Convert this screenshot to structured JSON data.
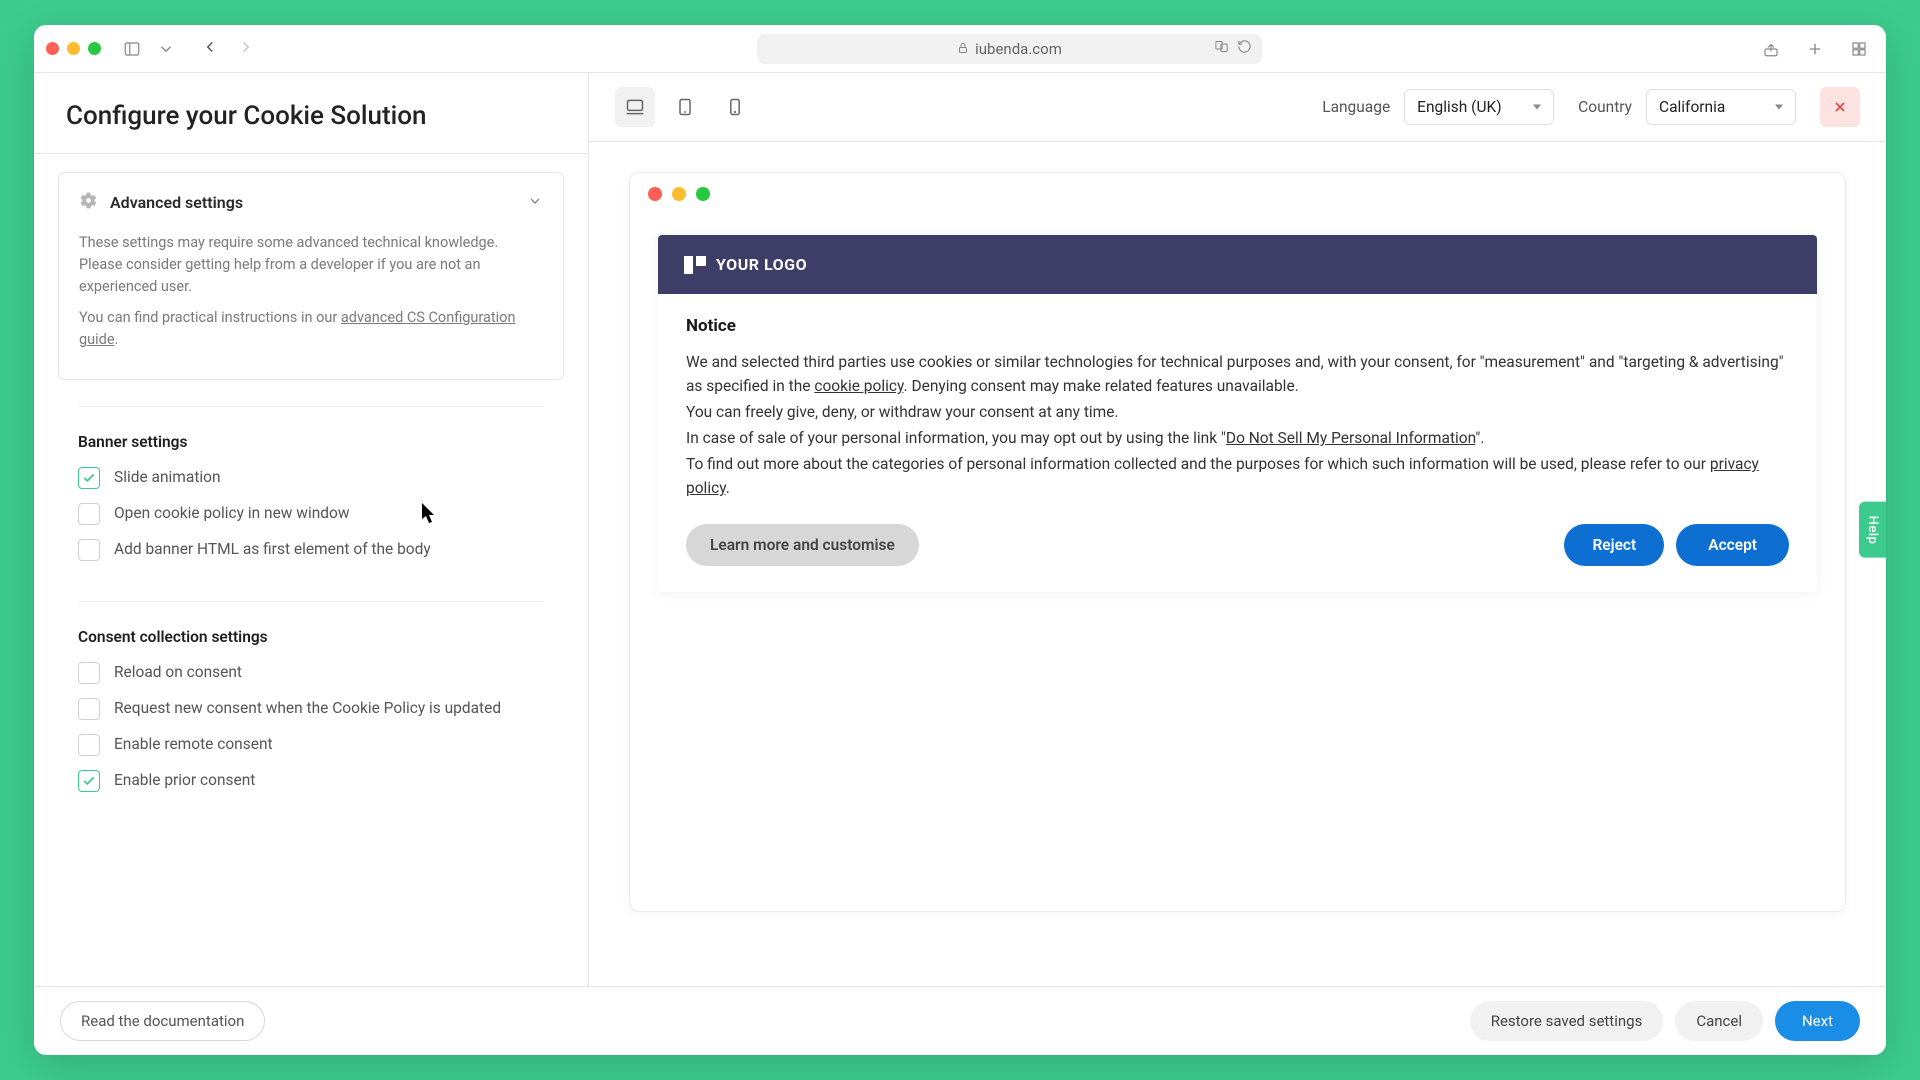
{
  "browser": {
    "url": "iubenda.com"
  },
  "sidebar": {
    "title": "Configure your Cookie Solution",
    "advanced": {
      "label": "Advanced settings",
      "text1": "These settings may require some advanced technical knowledge. Please consider getting help from a developer if you are not an experienced user.",
      "text2_pre": "You can find practical instructions in our ",
      "link": "advanced CS Configuration guide",
      "text2_post": "."
    },
    "banner": {
      "heading": "Banner settings",
      "options": [
        {
          "label": "Slide animation",
          "checked": true
        },
        {
          "label": "Open cookie policy in new window",
          "checked": false
        },
        {
          "label": "Add banner HTML as first element of the body",
          "checked": false
        }
      ]
    },
    "consent": {
      "heading": "Consent collection settings",
      "options": [
        {
          "label": "Reload on consent",
          "checked": false
        },
        {
          "label": "Request new consent when the Cookie Policy is updated",
          "checked": false
        },
        {
          "label": "Enable remote consent",
          "checked": false
        },
        {
          "label": "Enable prior consent",
          "checked": true
        }
      ]
    }
  },
  "header": {
    "language_label": "Language",
    "language_value": "English (UK)",
    "country_label": "Country",
    "country_value": "California"
  },
  "preview": {
    "logo_text": "YOUR LOGO",
    "notice_title": "Notice",
    "p1a": "We and selected third parties use cookies or similar technologies for technical purposes and, with your consent, for \"measurement\" and \"targeting & advertising\" as specified in the ",
    "cookie_policy": "cookie policy",
    "p1b": ". Denying consent may make related features unavailable.",
    "p2": "You can freely give, deny, or withdraw your consent at any time.",
    "p3a": "In case of sale of your personal information, you may opt out by using the link \"",
    "optout_link": "Do Not Sell My Personal Information",
    "p3b": "\".",
    "p4a": "To find out more about the categories of personal information collected and the purposes for which such information will be used, please refer to our ",
    "privacy_policy": "privacy policy",
    "p4b": ".",
    "learn": "Learn more and customise",
    "reject": "Reject",
    "accept": "Accept"
  },
  "footer": {
    "doc": "Read the documentation",
    "restore": "Restore saved settings",
    "cancel": "Cancel",
    "next": "Next"
  },
  "help": "Help"
}
